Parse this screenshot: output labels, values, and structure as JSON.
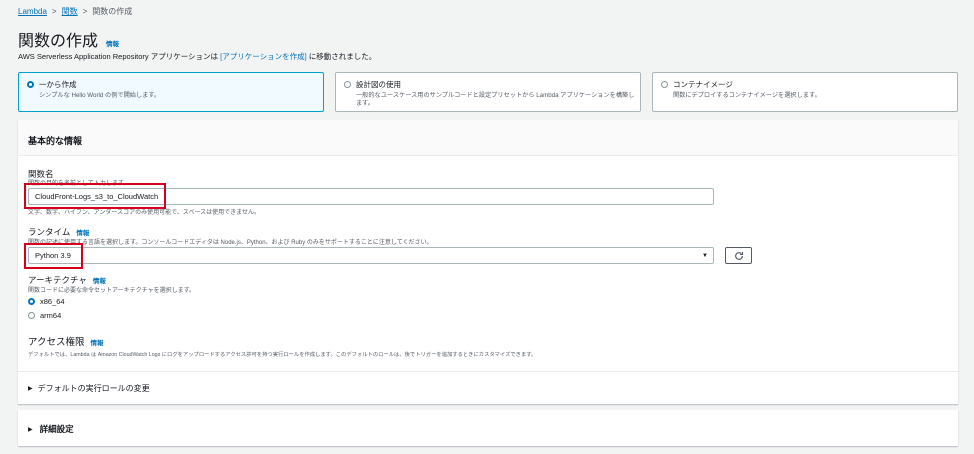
{
  "breadcrumb": {
    "lambda": "Lambda",
    "functions": "関数",
    "current": "関数の作成",
    "separator": ">"
  },
  "page": {
    "title": "関数の作成",
    "info": "情報"
  },
  "notice": {
    "prefix": "AWS Serverless Application Repository アプリケーションは ",
    "link": "[アプリケーションを作成]",
    "suffix": " に移動されました。"
  },
  "options": [
    {
      "title": "一から作成",
      "desc": "シンプルな Hello World の例で開始します。",
      "selected": true
    },
    {
      "title": "設計図の使用",
      "desc": "一般的なユースケース用のサンプルコードと設定プリセットから Lambda アプリケーションを構築します。",
      "selected": false
    },
    {
      "title": "コンテナイメージ",
      "desc": "関数にデプロイするコンテナイメージを選択します。",
      "selected": false
    }
  ],
  "basic": {
    "heading": "基本的な情報",
    "function_name": {
      "label": "関数名",
      "desc": "関数の目的を名前として入力します。",
      "value": "CloudFront-Logs_s3_to_CloudWatch",
      "hint": "文字、数字、ハイフン、アンダースコアのみ使用可能で、スペースは使用できません。"
    },
    "runtime": {
      "label": "ランタイム",
      "info": "情報",
      "desc": "関数の記述に使用する言語を選択します。コンソールコードエディタは Node.js、Python、および Ruby のみをサポートすることに注意してください。",
      "value": "Python 3.9"
    },
    "architecture": {
      "label": "アーキテクチャ",
      "info": "情報",
      "desc": "関数コードに必要な命令セットアーキテクチャを選択します。",
      "options": [
        {
          "label": "x86_64",
          "selected": true
        },
        {
          "label": "arm64",
          "selected": false
        }
      ]
    },
    "permissions": {
      "label": "アクセス権限",
      "info": "情報",
      "desc": "デフォルトでは、Lambda は Amazon CloudWatch Logs にログをアップロードするアクセス許可を持つ実行ロールを作成します。このデフォルトのロールは、後でトリガーを追加するときにカスタマイズできます。"
    },
    "default_role": "デフォルトの実行ロールの変更"
  },
  "advanced": {
    "heading": "詳細設定"
  },
  "colors": {
    "accent": "#0073bb",
    "highlight": "#d6001c",
    "selected_bg": "#f1faff"
  },
  "icons": {
    "refresh": "refresh-icon",
    "caret": "caret-right-icon",
    "dropdown": "chevron-down-icon"
  }
}
